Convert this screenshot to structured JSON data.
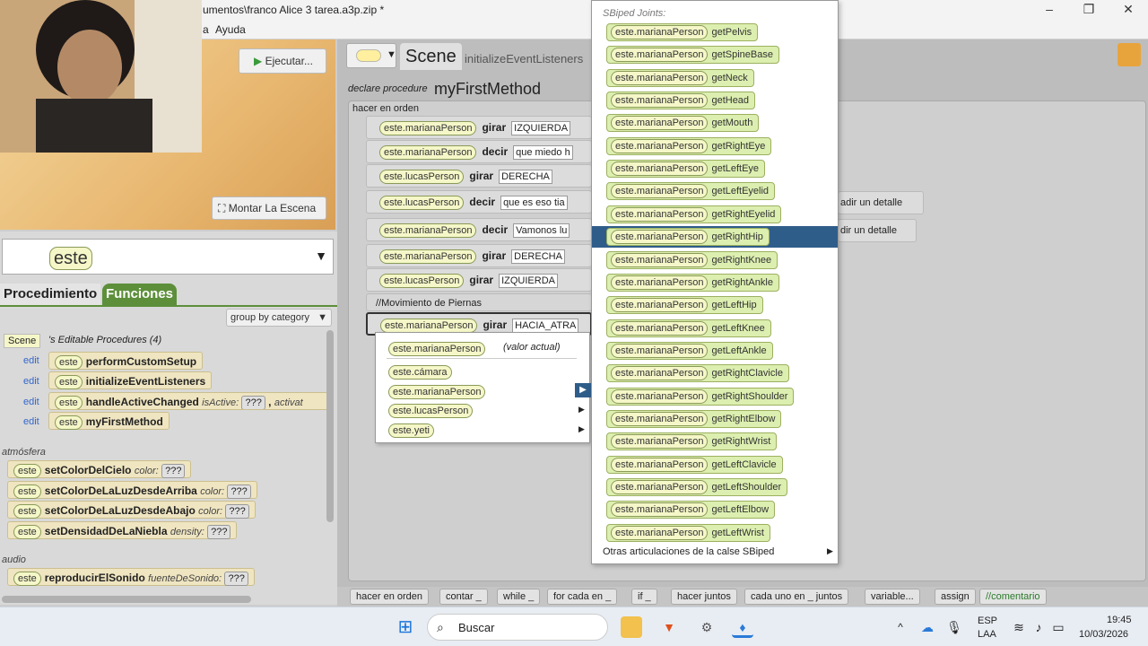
{
  "window": {
    "title": "umentos\\franco Alice 3 tarea.a3p.zip *",
    "menu_help": "Ayuda",
    "menu_partial": "a"
  },
  "preview": {
    "run_label": "Ejecutar...",
    "setup_scene_label": "Montar La Escena"
  },
  "left": {
    "combo_value": "este",
    "tabs": [
      "Procedimiento",
      "Funciones"
    ],
    "group_by": "group by category",
    "scene_label": "Scene",
    "editable_header": "'s Editable Procedures (4)",
    "edit_label": "edit",
    "procedures": [
      {
        "owner": "este",
        "name": "performCustomSetup"
      },
      {
        "owner": "este",
        "name": "initializeEventListeners"
      },
      {
        "owner": "este",
        "name": "handleActiveChanged",
        "arg": "isActive:",
        "arg2": "activat"
      },
      {
        "owner": "este",
        "name": "myFirstMethod"
      }
    ],
    "section_atmosphere": "atmósfera",
    "atmosphere": [
      {
        "owner": "este",
        "name": "setColorDelCielo",
        "arg": "color:"
      },
      {
        "owner": "este",
        "name": "setColorDeLaLuzDesdeArriba",
        "arg": "color:"
      },
      {
        "owner": "este",
        "name": "setColorDeLaLuzDesdeAbajo",
        "arg": "color:"
      },
      {
        "owner": "este",
        "name": "setDensidadDeLaNiebla",
        "arg": "density:"
      }
    ],
    "section_audio": "audio",
    "audio": [
      {
        "owner": "este",
        "name": "reproducirElSonido",
        "arg": "fuenteDeSonido:"
      }
    ],
    "unknown": "???"
  },
  "editor": {
    "scene_tab": "Scene",
    "tab2": "initializeEventListeners",
    "declare": "declare procedure",
    "method": "myFirstMethod",
    "do_in_order": "hacer en orden",
    "statements": [
      {
        "obj": "este.marianaPerson",
        "verb": "girar",
        "val": "IZQUIERDA"
      },
      {
        "obj": "este.marianaPerson",
        "verb": "decir",
        "val": "que miedo h"
      },
      {
        "obj": "este.lucasPerson",
        "verb": "girar",
        "val": "DERECHA"
      },
      {
        "obj": "este.lucasPerson",
        "verb": "decir",
        "val": "que es eso tia"
      },
      {
        "obj": "este.marianaPerson",
        "verb": "decir",
        "val": "Vamonos lu"
      },
      {
        "obj": "este.marianaPerson",
        "verb": "girar",
        "val": "DERECHA"
      },
      {
        "obj": "este.lucasPerson",
        "verb": "girar",
        "val": "IZQUIERDA"
      }
    ],
    "comment": "//Movimiento de Piernas",
    "last_stmt": {
      "obj": "este.marianaPerson",
      "verb": "girar",
      "val": "HACIA_ATRA"
    },
    "detail1": "adir un detalle",
    "detail2": "dir un detalle"
  },
  "context_menu": {
    "current": "este.marianaPerson",
    "current_note": "(valor actual)",
    "items": [
      "este.cámara",
      "este.marianaPerson",
      "este.lucasPerson",
      "este.yeti"
    ]
  },
  "joint_menu": {
    "header": "SBiped Joints:",
    "owner": "este.marianaPerson",
    "joints": [
      "getPelvis",
      "getSpineBase",
      "getNeck",
      "getHead",
      "getMouth",
      "getRightEye",
      "getLeftEye",
      "getLeftEyelid",
      "getRightEyelid",
      "getRightHip",
      "getRightKnee",
      "getRightAnkle",
      "getLeftHip",
      "getLeftKnee",
      "getLeftAnkle",
      "getRightClavicle",
      "getRightShoulder",
      "getRightElbow",
      "getRightWrist",
      "getLeftClavicle",
      "getLeftShoulder",
      "getLeftElbow",
      "getLeftWrist"
    ],
    "more": "Otras articulaciones de la calse SBiped"
  },
  "bottom_bar": [
    "hacer en orden",
    "contar _",
    "while _",
    "for cada en _",
    "if _",
    "hacer juntos",
    "cada uno en _ juntos",
    "variable...",
    "assign",
    "//comentario"
  ],
  "taskbar": {
    "search": "Buscar",
    "lang1": "ESP",
    "lang2": "LAA",
    "time": "19:45",
    "date": "10/03/2026"
  }
}
